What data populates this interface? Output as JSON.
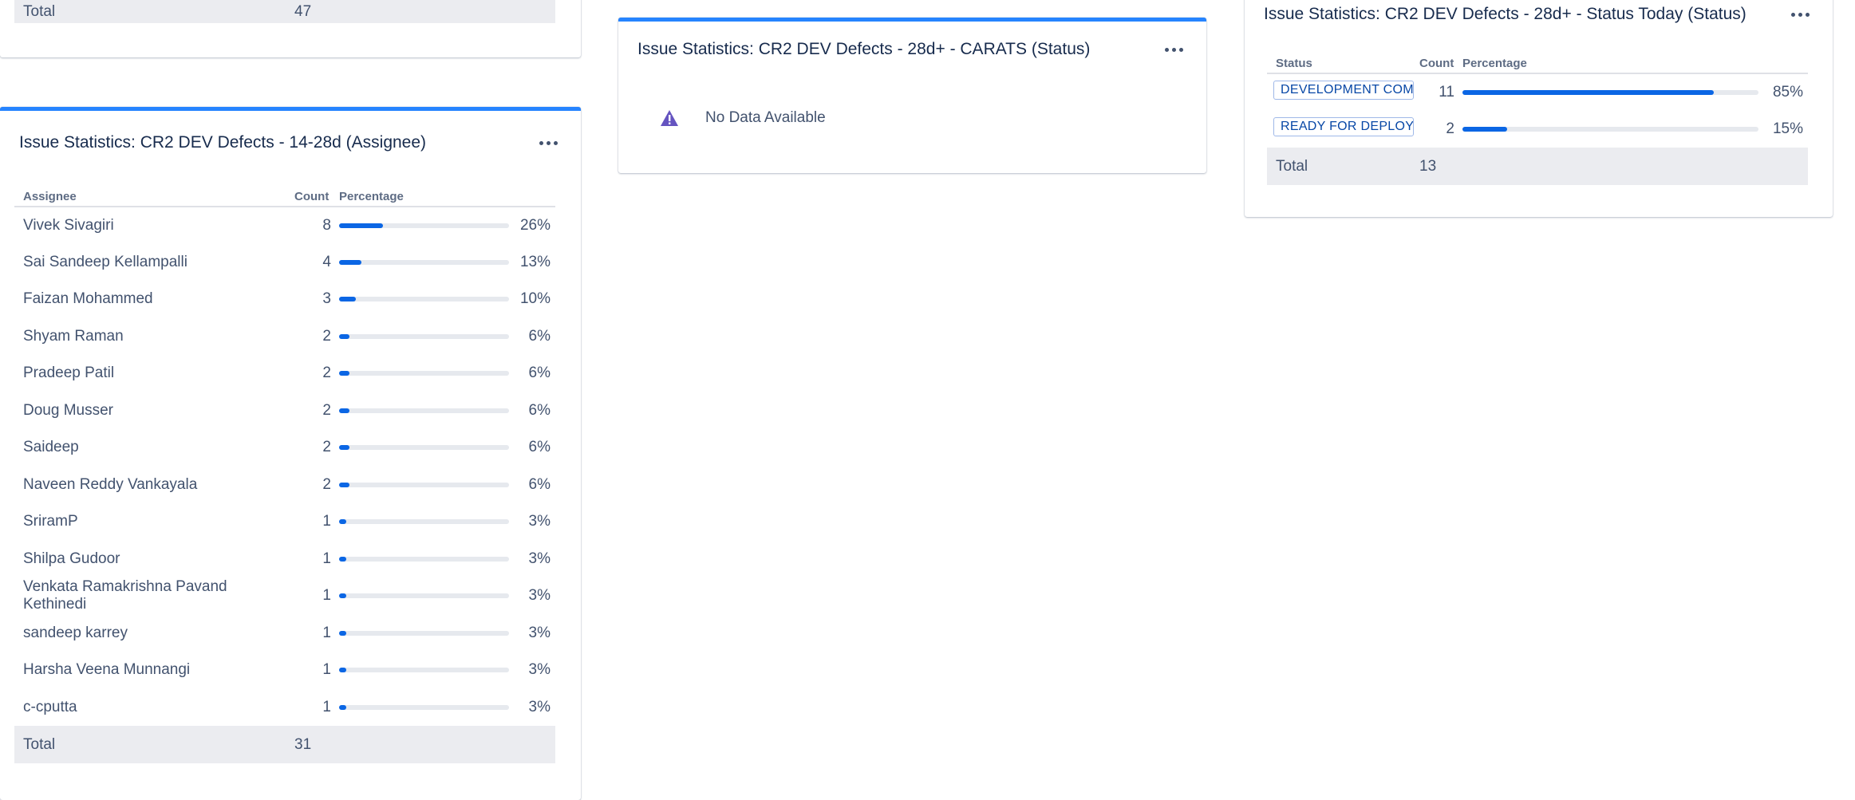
{
  "prev_gadget": {
    "total_label": "Total",
    "total_count": "47"
  },
  "assignee_gadget": {
    "title": "Issue Statistics: CR2 DEV Defects - 14-28d (Assignee)",
    "columns": {
      "name": "Assignee",
      "count": "Count",
      "pct": "Percentage"
    },
    "rows": [
      {
        "name": "Vivek Sivagiri",
        "count": "8",
        "pct": "26%",
        "fraction": 0.26
      },
      {
        "name": "Sai Sandeep Kellampalli",
        "count": "4",
        "pct": "13%",
        "fraction": 0.13
      },
      {
        "name": "Faizan Mohammed",
        "count": "3",
        "pct": "10%",
        "fraction": 0.1
      },
      {
        "name": "Shyam Raman",
        "count": "2",
        "pct": "6%",
        "fraction": 0.06
      },
      {
        "name": "Pradeep Patil",
        "count": "2",
        "pct": "6%",
        "fraction": 0.06
      },
      {
        "name": "Doug Musser",
        "count": "2",
        "pct": "6%",
        "fraction": 0.06
      },
      {
        "name": "Saideep",
        "count": "2",
        "pct": "6%",
        "fraction": 0.06
      },
      {
        "name": "Naveen Reddy Vankayala",
        "count": "2",
        "pct": "6%",
        "fraction": 0.06
      },
      {
        "name": "SriramP",
        "count": "1",
        "pct": "3%",
        "fraction": 0.03
      },
      {
        "name": "Shilpa Gudoor",
        "count": "1",
        "pct": "3%",
        "fraction": 0.03
      },
      {
        "name": "Venkata Ramakrishna Pavand Kethinedi",
        "count": "1",
        "pct": "3%",
        "fraction": 0.03
      },
      {
        "name": "sandeep karrey",
        "count": "1",
        "pct": "3%",
        "fraction": 0.03
      },
      {
        "name": "Harsha Veena Munnangi",
        "count": "1",
        "pct": "3%",
        "fraction": 0.03
      },
      {
        "name": "c-cputta",
        "count": "1",
        "pct": "3%",
        "fraction": 0.03
      }
    ],
    "total_label": "Total",
    "total_count": "31"
  },
  "carats_gadget": {
    "title": "Issue Statistics: CR2 DEV Defects - 28d+ - CARATS (Status)",
    "no_data": "No Data Available"
  },
  "status_gadget": {
    "title": "Issue Statistics: CR2 DEV Defects - 28d+ - Status Today (Status)",
    "columns": {
      "name": "Status",
      "count": "Count",
      "pct": "Percentage"
    },
    "rows": [
      {
        "name": "DEVELOPMENT COMP...",
        "count": "11",
        "pct": "85%",
        "fraction": 0.85
      },
      {
        "name": "READY FOR DEPLOYM...",
        "count": "2",
        "pct": "15%",
        "fraction": 0.15
      }
    ],
    "total_label": "Total",
    "total_count": "13"
  },
  "colors": {
    "accent": "#2684ff",
    "bar": "#0b66e4",
    "warning": "#6554c0"
  }
}
